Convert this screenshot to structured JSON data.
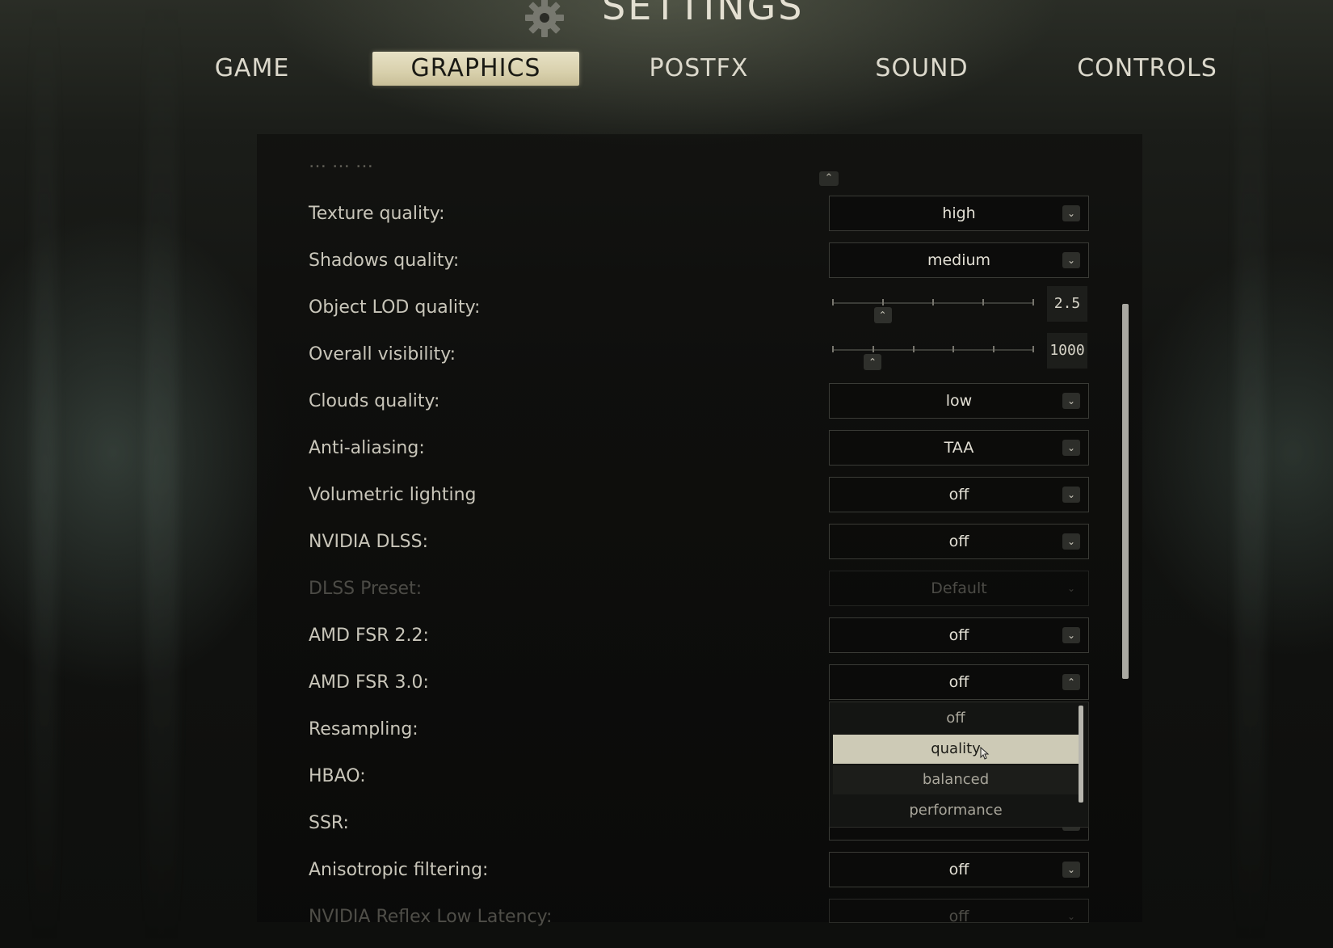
{
  "title": "SETTINGS",
  "tabs": [
    {
      "label": "GAME"
    },
    {
      "label": "GRAPHICS"
    },
    {
      "label": "POSTFX"
    },
    {
      "label": "SOUND"
    },
    {
      "label": "CONTROLS"
    }
  ],
  "active_tab": "GRAPHICS",
  "settings": {
    "texture": {
      "label": "Texture quality:",
      "value": "high"
    },
    "shadows": {
      "label": "Shadows quality:",
      "value": "medium"
    },
    "lod": {
      "label": "Object LOD quality:",
      "value": "2.5",
      "slider_fraction": 0.25
    },
    "visibility": {
      "label": "Overall visibility:",
      "value": "1000",
      "slider_fraction": 0.2
    },
    "clouds": {
      "label": "Clouds quality:",
      "value": "low"
    },
    "antialiasing": {
      "label": "Anti-aliasing:",
      "value": "TAA"
    },
    "volumetric": {
      "label": "Volumetric lighting",
      "value": "off"
    },
    "dlss": {
      "label": "NVIDIA DLSS:",
      "value": "off"
    },
    "dlss_preset": {
      "label": "DLSS Preset:",
      "value": "Default"
    },
    "fsr22": {
      "label": "AMD FSR 2.2:",
      "value": "off"
    },
    "fsr30": {
      "label": "AMD FSR 3.0:",
      "value": "off"
    },
    "resampling": {
      "label": "Resampling:"
    },
    "hbao": {
      "label": "HBAO:"
    },
    "ssr": {
      "label": "SSR:"
    },
    "anisotropic": {
      "label": "Anisotropic filtering:",
      "value": "off"
    },
    "reflex": {
      "label": "NVIDIA Reflex Low Latency:",
      "value": "off"
    }
  },
  "fsr30_options": [
    "off",
    "quality",
    "balanced",
    "performance"
  ],
  "fsr30_highlighted": "quality",
  "colors": {
    "active_tab_bg": "#d8d0ac",
    "highlight_option_bg": "#cdcab6",
    "text_primary": "#c9c6ba",
    "text_disabled": "#4c4b46"
  },
  "icons": {
    "header": "gear-icon",
    "dropdown": "chevron-down-icon",
    "dropdown_open": "chevron-up-icon",
    "slider_handle": "chevron-up-icon",
    "pointer": "cursor-icon"
  }
}
